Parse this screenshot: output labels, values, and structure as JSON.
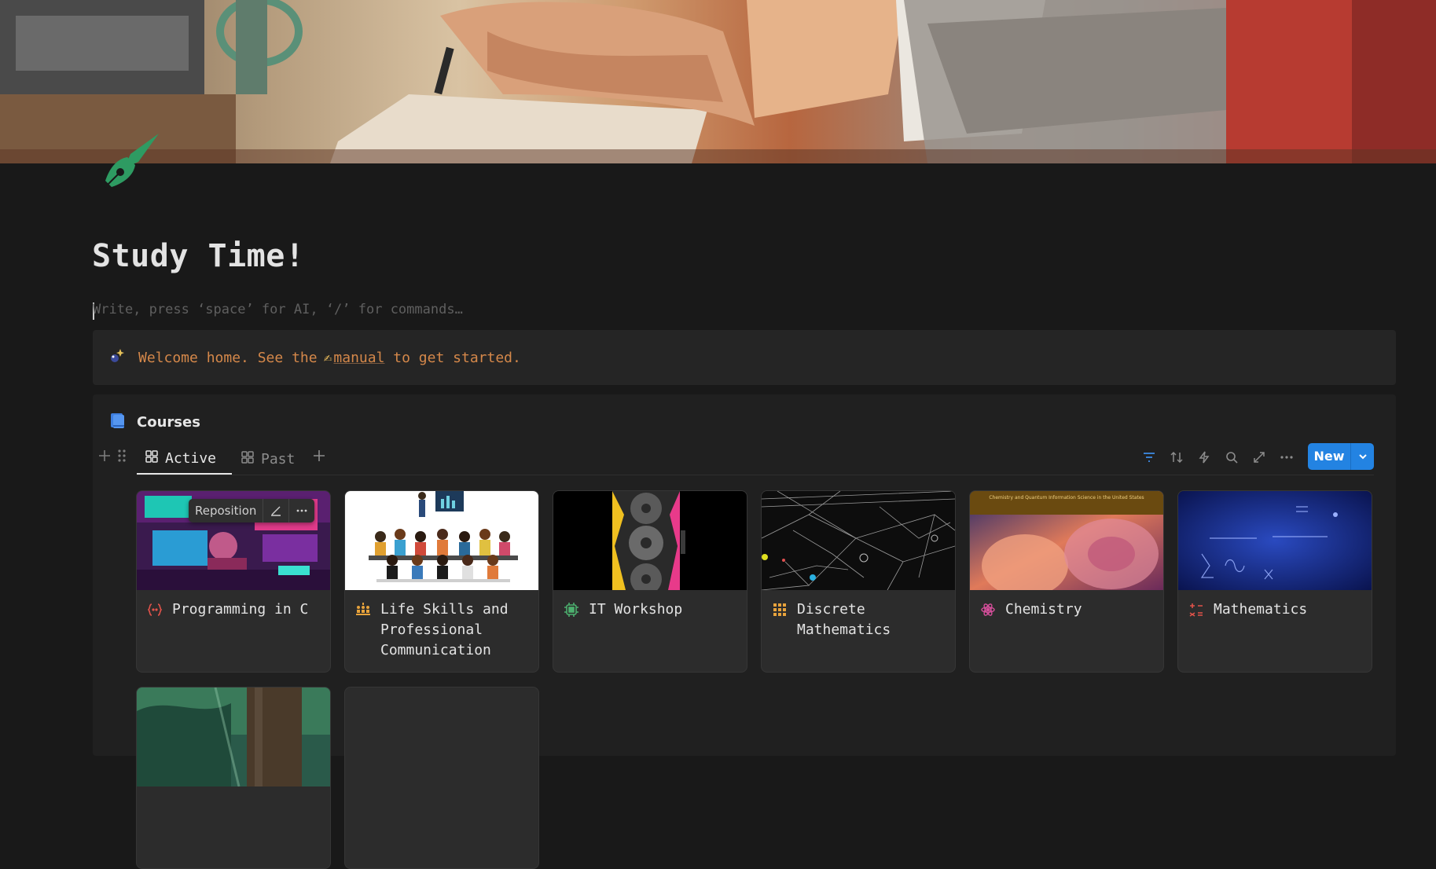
{
  "page": {
    "title": "Study Time!",
    "placeholder": "Write, press ‘space’ for AI, ‘/’ for commands…",
    "icon": "fountain-pen-icon"
  },
  "callout": {
    "icon": "sparkle-icon",
    "text_before": "Welcome home. See the ",
    "hand_icon": "writing-hand-icon",
    "link_text": "manual",
    "text_after": " to get started."
  },
  "database": {
    "icon": "book-icon",
    "title": "Courses",
    "tabs": [
      {
        "label": "Active",
        "icon": "gallery-icon",
        "active": true
      },
      {
        "label": "Past",
        "icon": "gallery-icon",
        "active": false
      }
    ],
    "toolbar": [
      "filter-icon",
      "sort-icon",
      "automation-icon",
      "search-icon",
      "expand-icon",
      "more-icon"
    ],
    "new_label": "New",
    "card_toolbar": {
      "reposition_label": "Reposition"
    },
    "cards": [
      {
        "title": "Programming in C",
        "icon": "code-braces-icon",
        "icon_color": "#e0524a"
      },
      {
        "title": "Life Skills and Professional Communication",
        "icon": "audience-icon",
        "icon_color": "#e8a33c"
      },
      {
        "title": "IT Workshop",
        "icon": "chip-icon",
        "icon_color": "#4caf6e"
      },
      {
        "title": "Discrete Mathematics",
        "icon": "grid-icon",
        "icon_color": "#e8a33c"
      },
      {
        "title": "Chemistry",
        "icon": "atom-icon",
        "icon_color": "#d64f9b"
      },
      {
        "title": "Mathematics",
        "icon": "math-ops-icon",
        "icon_color": "#e0524a"
      }
    ],
    "thumb_texts": {
      "chemistry_banner": "Chemistry and Quantum Information Science in the United States"
    }
  },
  "colors": {
    "accent": "#2383e2",
    "callout_text": "#d5884a",
    "background": "#191919"
  }
}
